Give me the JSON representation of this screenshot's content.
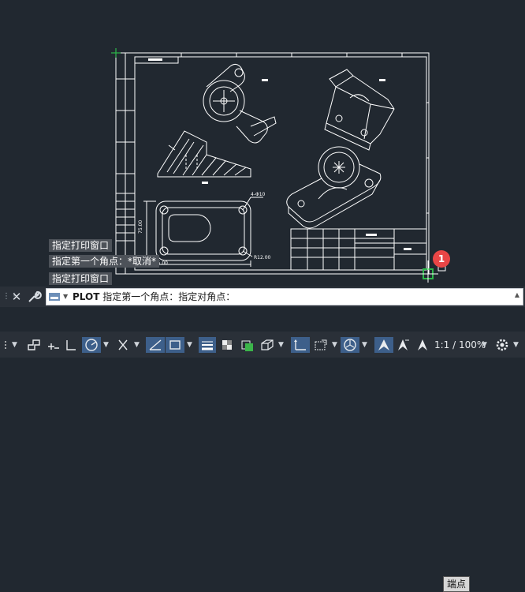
{
  "history": [
    "指定打印窗口",
    "指定第一个角点：*取消*",
    "指定打印窗口"
  ],
  "command_line": {
    "keyword": "PLOT",
    "prompt": "指定第一个角点：指定对角点："
  },
  "tooltip": "端点",
  "badge": "1",
  "drawing_labels": {
    "dim_width": "165.00",
    "dim_height": "75.00",
    "dim_radius": "R12.00",
    "dim_hole": "4-Φ10"
  },
  "status_bar": {
    "zoom": "1:1 / 100%"
  },
  "colors": {
    "background": "#212830",
    "drawing_lines": "#ffffff",
    "pick_marker": "#2db84a",
    "badge": "#e94646",
    "active_toggle": "#3d5f8a"
  }
}
